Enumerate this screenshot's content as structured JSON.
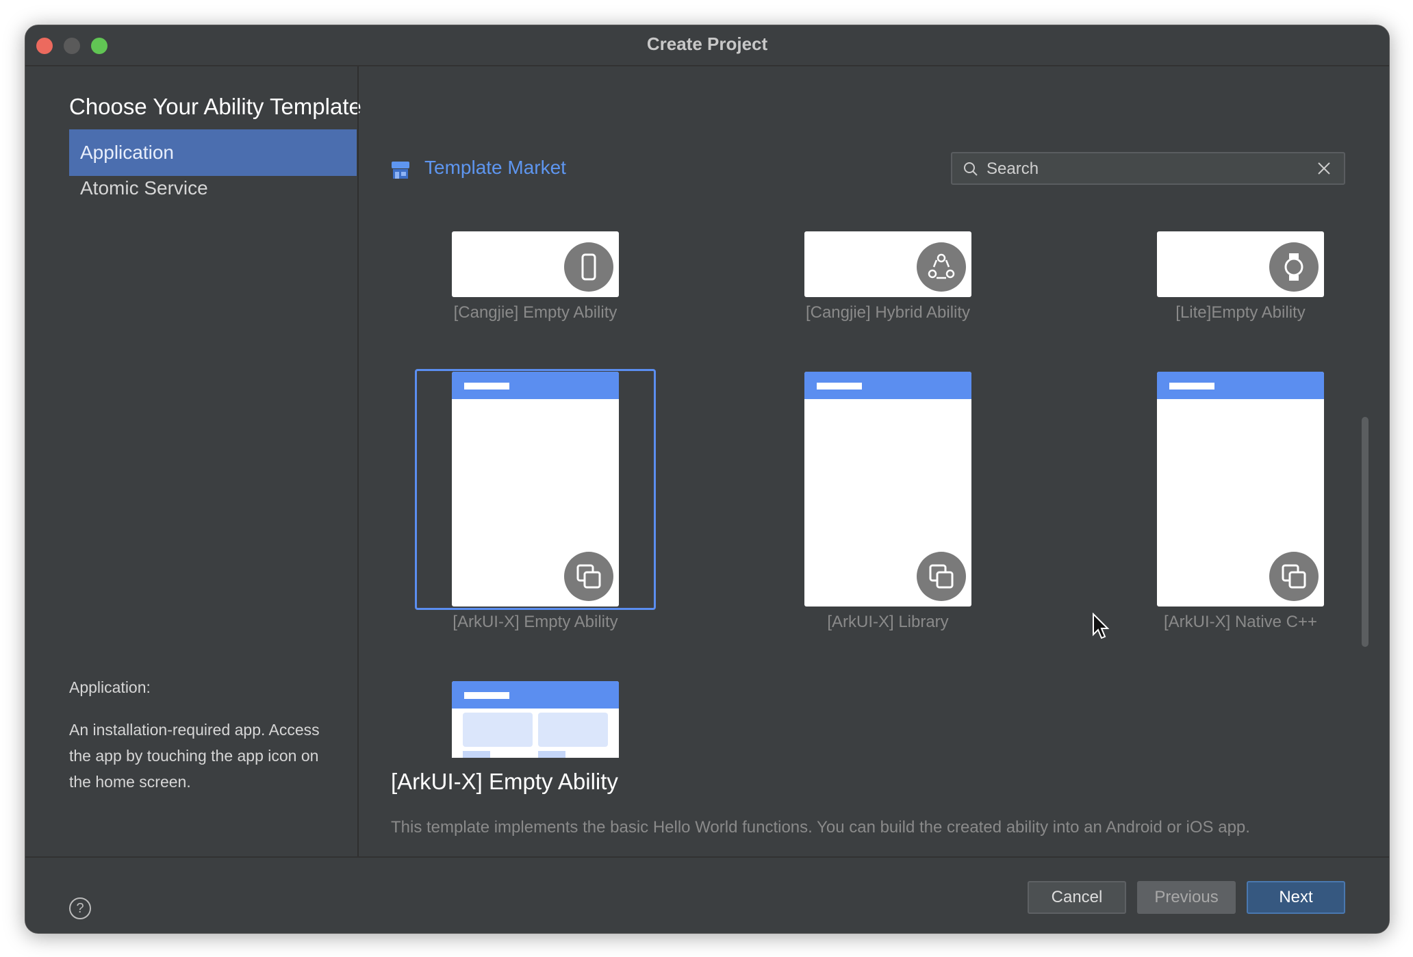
{
  "window": {
    "title": "Create Project"
  },
  "heading": "Choose Your Ability Template",
  "sidebar": {
    "items": [
      {
        "label": "Application",
        "selected": true
      },
      {
        "label": "Atomic Service",
        "selected": false
      }
    ],
    "description_title": "Application:",
    "description_body": "An installation-required app. Access the app by touching the app icon on the home screen."
  },
  "market": {
    "label": "Template Market",
    "icon": "store-icon"
  },
  "search": {
    "placeholder": "Search",
    "value": ""
  },
  "templates": [
    {
      "label": "[Cangjie] Empty Ability",
      "badge_icon": "phone-icon"
    },
    {
      "label": "[Cangjie] Hybrid Ability",
      "badge_icon": "hybrid-icon"
    },
    {
      "label": "[Lite]Empty Ability",
      "badge_icon": "watch-icon"
    },
    {
      "label": "[ArkUI-X] Empty Ability",
      "badge_icon": "cross-platform-icon",
      "selected": true
    },
    {
      "label": "[ArkUI-X] Library",
      "badge_icon": "cross-platform-icon"
    },
    {
      "label": "[ArkUI-X] Native C++",
      "badge_icon": "cross-platform-icon"
    }
  ],
  "detail": {
    "title": "[ArkUI-X] Empty Ability",
    "description": "This template implements the basic Hello World functions. You can build the created ability into an Android or iOS app."
  },
  "footer": {
    "help": "?",
    "cancel": "Cancel",
    "previous": "Previous",
    "next": "Next"
  },
  "colors": {
    "accent": "#5b8ef0",
    "background": "#3c3f41",
    "selection": "#4b6eaf"
  }
}
